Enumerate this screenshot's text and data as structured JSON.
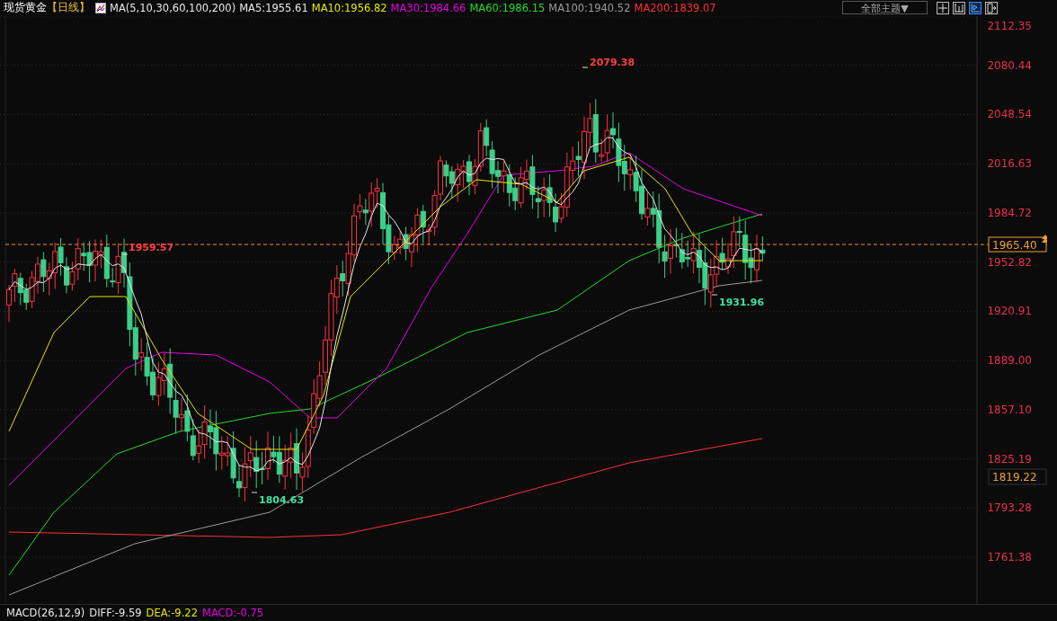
{
  "header": {
    "symbol": "现货黄金",
    "period": "【日线】",
    "indicator": "MA(5,10,30,60,100,200)",
    "ma_values": [
      {
        "text": "MA5:1955.61",
        "color": "#e8e8e8"
      },
      {
        "text": "MA10:1956.82",
        "color": "#e6e600"
      },
      {
        "text": "MA30:1984.66",
        "color": "#e600e6"
      },
      {
        "text": "MA60:1986.15",
        "color": "#22dd22"
      },
      {
        "text": "MA100:1940.52",
        "color": "#9a9a9a"
      },
      {
        "text": "MA200:1839.07",
        "color": "#ff3030"
      }
    ]
  },
  "toolbar": {
    "theme_dropdown": "全部主题▼",
    "tools": [
      {
        "kind": "crosshair",
        "selected": false
      },
      {
        "kind": "bars",
        "selected": false
      },
      {
        "kind": "chart",
        "selected": true
      },
      {
        "kind": "exit",
        "selected": false
      }
    ]
  },
  "chart": {
    "y_ticks": [
      "2112.35",
      "2080.44",
      "2048.54",
      "2016.63",
      "1984.72",
      "1952.82",
      "1920.91",
      "1889.00",
      "1857.10",
      "1825.19",
      "1793.28",
      "1761.38"
    ],
    "annotations": [
      {
        "text": "2079.38",
        "kind": "high"
      },
      {
        "text": "1959.57",
        "kind": "high"
      },
      {
        "text": "1931.96",
        "kind": "low"
      },
      {
        "text": "1804.63",
        "kind": "low"
      }
    ],
    "current_price": "1965.40",
    "marker_price": "1819.22"
  },
  "macd": {
    "label": "MACD(26,12,9)",
    "values": [
      {
        "text": "DIFF:-9.59",
        "color": "#e8e8e8"
      },
      {
        "text": "DEA:-9.22",
        "color": "#e6e600"
      },
      {
        "text": "MACD:-0.75",
        "color": "#e600e6"
      }
    ]
  }
}
